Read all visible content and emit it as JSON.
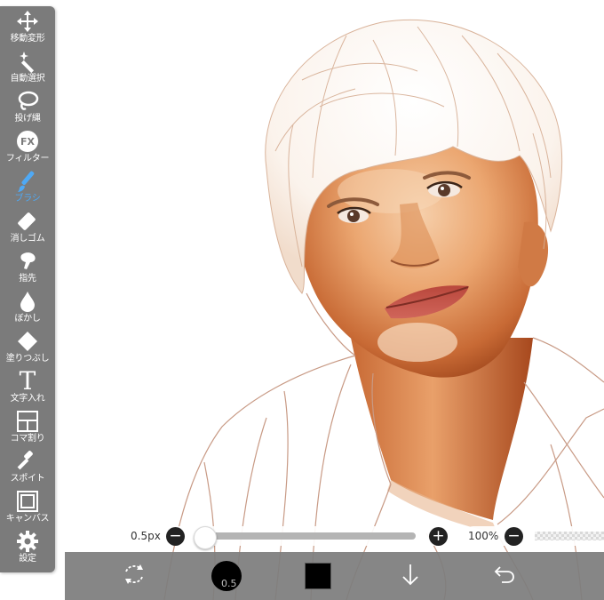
{
  "toolbar": {
    "items": [
      {
        "label": "移動変形",
        "icon": "move-icon",
        "active": false
      },
      {
        "label": "自動選択",
        "icon": "magic-wand-icon",
        "active": false
      },
      {
        "label": "投げ縄",
        "icon": "lasso-icon",
        "active": false
      },
      {
        "label": "フィルター",
        "icon": "fx-icon",
        "active": false
      },
      {
        "label": "ブラシ",
        "icon": "brush-icon",
        "active": true
      },
      {
        "label": "消しゴム",
        "icon": "eraser-icon",
        "active": false
      },
      {
        "label": "指先",
        "icon": "finger-icon",
        "active": false
      },
      {
        "label": "ぼかし",
        "icon": "blur-drop-icon",
        "active": false
      },
      {
        "label": "塗りつぶし",
        "icon": "bucket-icon",
        "active": false
      },
      {
        "label": "文字入れ",
        "icon": "text-icon",
        "active": false
      },
      {
        "label": "コマ割り",
        "icon": "frame-divider-icon",
        "active": false
      },
      {
        "label": "スポイト",
        "icon": "eyedropper-icon",
        "active": false
      },
      {
        "label": "キャンバス",
        "icon": "canvas-icon",
        "active": false
      },
      {
        "label": "設定",
        "icon": "gear-icon",
        "active": false
      }
    ],
    "fx_text": "FX",
    "text_tool_glyph": "T"
  },
  "brush_controls": {
    "size_label": "0.5px",
    "size_fraction": 0.0,
    "opacity_label": "100%",
    "minus_glyph": "−",
    "plus_glyph": "+"
  },
  "bottom_bar": {
    "brush_size_value": "0.5",
    "current_color": "#000000",
    "icons": [
      "transform-arrows-icon",
      "brush-size-icon",
      "color-swatch-icon",
      "arrow-down-icon",
      "undo-icon"
    ]
  },
  "colors": {
    "toolbar_bg": "#7b7b7b",
    "active_accent": "#4fa9f5",
    "line_art": "#c08a70",
    "skin": "#e9a36d"
  }
}
